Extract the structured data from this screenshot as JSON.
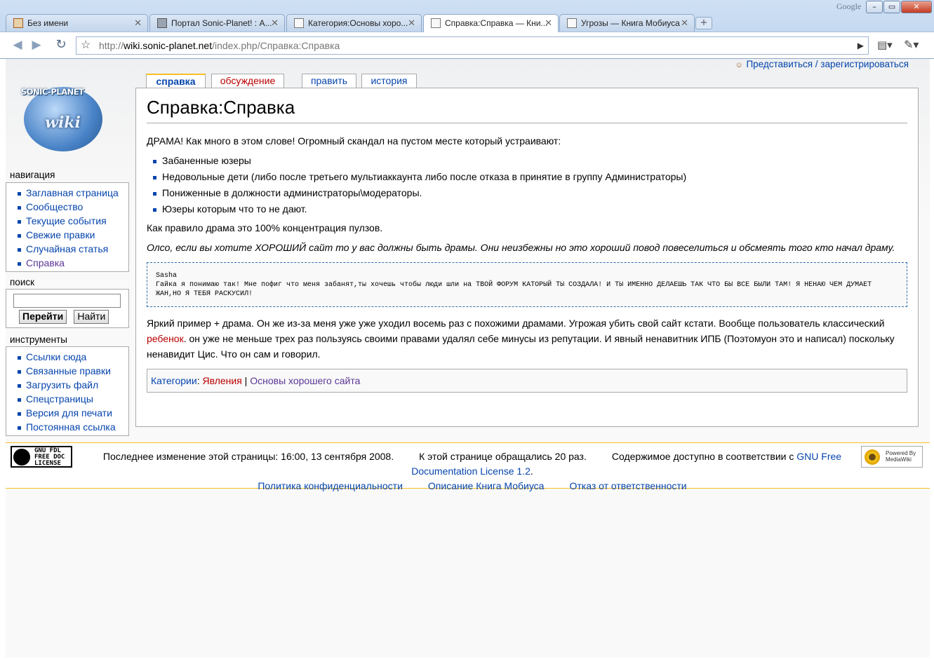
{
  "browser": {
    "brand": "Google",
    "tabs": [
      {
        "title": "Без имени",
        "icon": "gift-icon"
      },
      {
        "title": "Портал Sonic-Planet! : А...",
        "icon": "box-icon"
      },
      {
        "title": "Категория:Основы хоро...",
        "icon": "page-icon"
      },
      {
        "title": "Справка:Справка — Кни...",
        "icon": "page-icon",
        "active": true
      },
      {
        "title": "Угрозы — Книга Мобиуса",
        "icon": "page-icon"
      }
    ],
    "url_prefix": "http://",
    "url_host": "wiki.sonic-planet.net",
    "url_path": "/index.php/Справка:Справка"
  },
  "personal": {
    "login": "Представиться / зарегистрироваться"
  },
  "logo": {
    "top": "SONIC-PLANET",
    "mid": "wiki"
  },
  "sidebar": {
    "nav_title": "навигация",
    "nav_items": [
      "Заглавная страница",
      "Сообщество",
      "Текущие события",
      "Свежие правки",
      "Случайная статья",
      "Справка"
    ],
    "search_title": "поиск",
    "search_value": "",
    "go_label": "Перейти",
    "search_label": "Найти",
    "tools_title": "инструменты",
    "tools_items": [
      "Ссылки сюда",
      "Связанные правки",
      "Загрузить файл",
      "Спецстраницы",
      "Версия для печати",
      "Постоянная ссылка"
    ]
  },
  "tabs": {
    "page": "справка",
    "discussion": "обсуждение",
    "edit": "править",
    "history": "история"
  },
  "article": {
    "title": "Справка:Справка",
    "intro": "ДРАМА! Как много в этом слове! Огромный скандал на пустом месте который устраивают:",
    "list": [
      "Забаненные юзеры",
      "Недовольные дети (либо после третьего мультиаккаунта либо после отказа в принятие в группу Администраторы)",
      "Пониженные в должности администраторы\\модераторы.",
      "Юзеры которым что то не дают."
    ],
    "rule": "Как правило драма это 100% концентрация пулзов.",
    "italic": "Олсо, если вы хотите ХОРОШИЙ сайт то у вас должны быть драмы. Они неизбежны но это хороший повод повеселиться и обсмеять того кто начал драму.",
    "quote_author": "Sasha",
    "quote_text": "Гайка я понимаю так! Мне пофиг что меня забанят,ты хочешь чтобы люди шли на ТВОЙ ФОРУМ КАТОРЫЙ ТЫ СОЗДАЛА! И ТЫ ИМЕННО ДЕЛАЕШЬ ТАК ЧТО БЫ ВСЕ БЫЛИ ТАМ! Я НЕНАЮ ЧЕМ ДУМАЕТ ЖАН,НО Я ТЕБЯ РАСКУСИЛ!",
    "example_before": "Яркий пример + драма. Он же из-за меня уже уже уходил восемь раз с похожими драмами. Угрожая убить свой сайт кстати. Вообще пользователь классический ",
    "example_link": "ребенок",
    "example_after": ". он уже не меньше трех раз пользуясь своими правами удалял себе минусы из репутации. И явный ненавитник ИПБ (Поэтомуон это и написал) поскольку ненавидит Цис. Что он сам и говорил.",
    "categories_label": "Категории",
    "categories": [
      "Явления",
      "Основы хорошего сайта"
    ]
  },
  "footer": {
    "gfdl": "GNU FDL FREE DOC LICENSE",
    "mediawiki": "Powered By MediaWiki",
    "last_modified": "Последнее изменение этой страницы: 16:00, 13 сентября 2008.",
    "views": "К этой странице обращались 20 раз.",
    "license_before": "Содержимое доступно в соответствии с ",
    "license_link": "GNU Free Documentation License 1.2",
    "privacy": "Политика конфиденциальности",
    "about": "Описание Книга Мобиуса",
    "disclaimer": "Отказ от ответственности"
  }
}
